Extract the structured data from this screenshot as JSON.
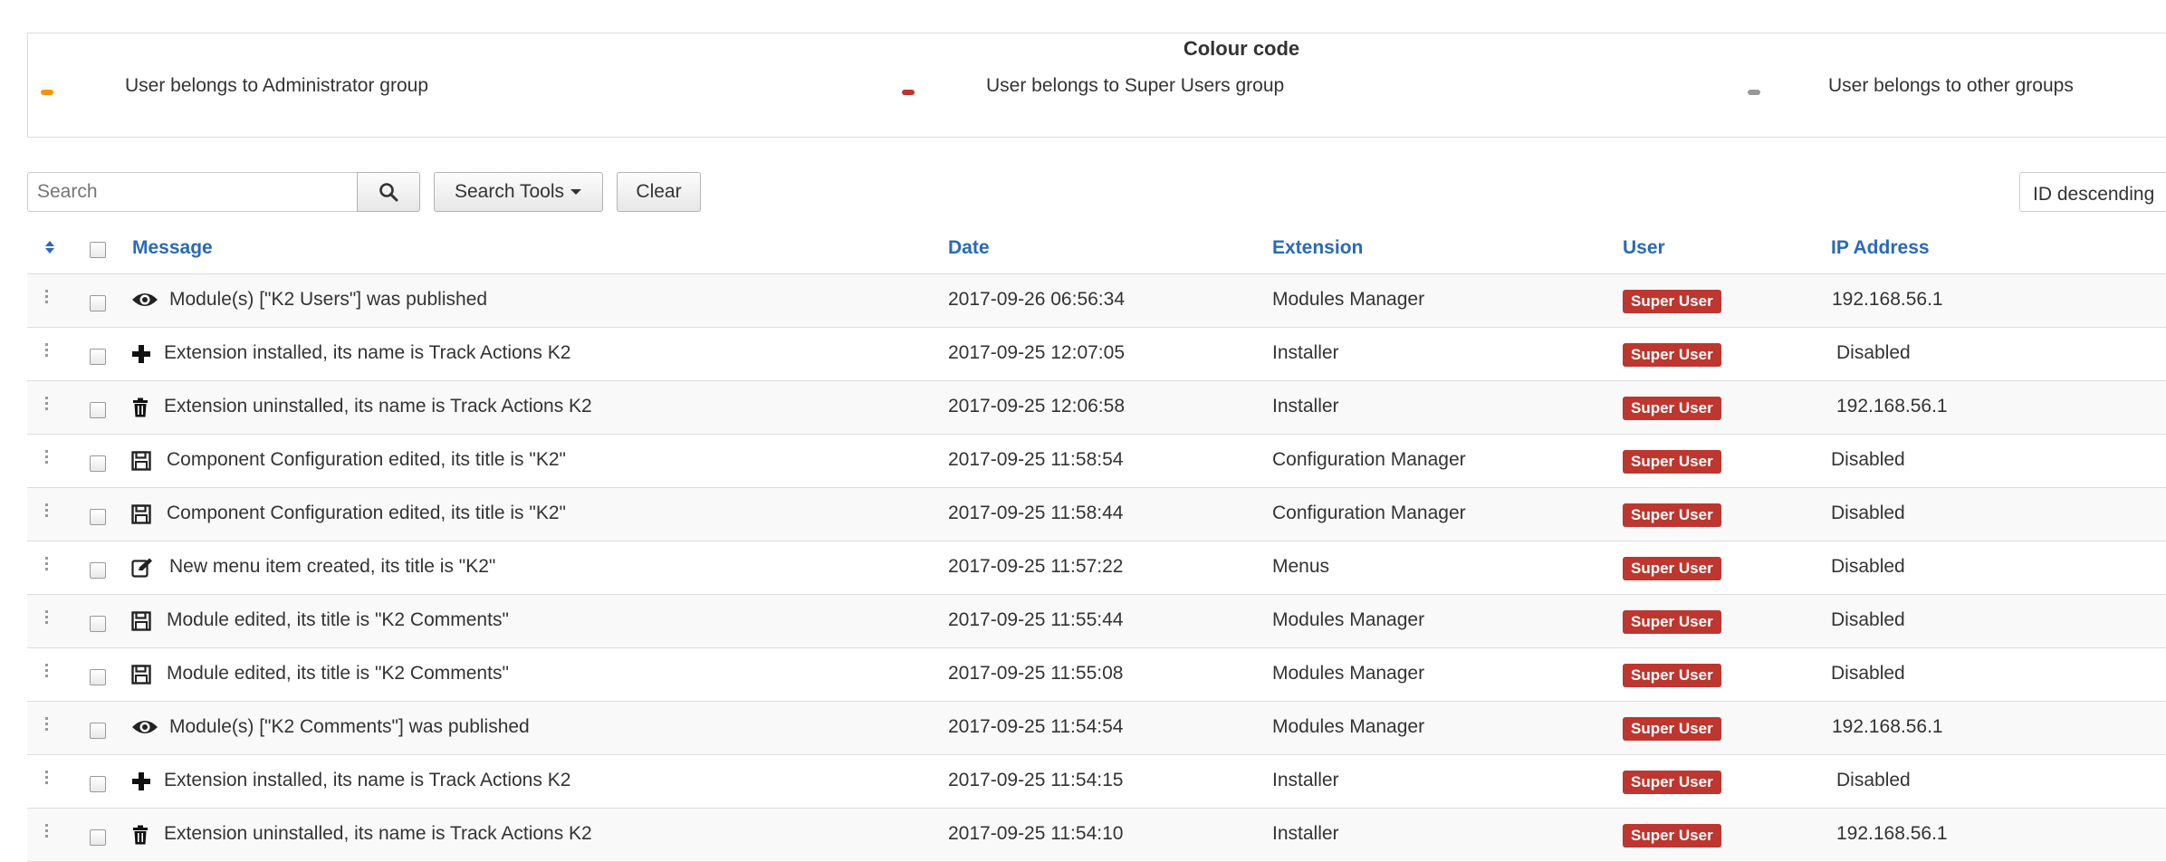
{
  "legend": {
    "title": "Colour code",
    "items": [
      {
        "label": "User belongs to Administrator group",
        "color": "#f89406"
      },
      {
        "label": "User belongs to Super Users group",
        "color": "#bd362f"
      },
      {
        "label": "User belongs to other groups",
        "color": "#999999"
      }
    ]
  },
  "toolbar": {
    "search_placeholder": "Search",
    "search_tools_label": "Search Tools",
    "clear_label": "Clear",
    "sort_label": "ID descending"
  },
  "table": {
    "headers": {
      "message": "Message",
      "date": "Date",
      "extension": "Extension",
      "user": "User",
      "ip": "IP Address"
    },
    "rows": [
      {
        "icon": "eye-icon",
        "message": "Module(s) [\"K2 Users\"] was published",
        "date": "2017-09-26 06:56:34",
        "extension": "Modules Manager",
        "user": "Super User",
        "ip": "192.168.56.1"
      },
      {
        "icon": "plus-icon",
        "message": "Extension installed, its name is Track Actions K2",
        "date": "2017-09-25 12:07:05",
        "extension": "Installer",
        "user": "Super User",
        "ip": "Disabled"
      },
      {
        "icon": "trash-icon",
        "message": "Extension uninstalled, its name is Track Actions K2",
        "date": "2017-09-25 12:06:58",
        "extension": "Installer",
        "user": "Super User",
        "ip": "192.168.56.1"
      },
      {
        "icon": "save-icon",
        "message": "Component Configuration edited, its title is \"K2\"",
        "date": "2017-09-25 11:58:54",
        "extension": "Configuration Manager",
        "user": "Super User",
        "ip": "Disabled"
      },
      {
        "icon": "save-icon",
        "message": "Component Configuration edited, its title is \"K2\"",
        "date": "2017-09-25 11:58:44",
        "extension": "Configuration Manager",
        "user": "Super User",
        "ip": "Disabled"
      },
      {
        "icon": "edit-icon",
        "message": "New menu item created, its title is \"K2\"",
        "date": "2017-09-25 11:57:22",
        "extension": "Menus",
        "user": "Super User",
        "ip": "Disabled"
      },
      {
        "icon": "save-icon",
        "message": "Module edited, its title is \"K2 Comments\"",
        "date": "2017-09-25 11:55:44",
        "extension": "Modules Manager",
        "user": "Super User",
        "ip": "Disabled"
      },
      {
        "icon": "save-icon",
        "message": "Module edited, its title is \"K2 Comments\"",
        "date": "2017-09-25 11:55:08",
        "extension": "Modules Manager",
        "user": "Super User",
        "ip": "Disabled"
      },
      {
        "icon": "eye-icon",
        "message": "Module(s) [\"K2 Comments\"] was published",
        "date": "2017-09-25 11:54:54",
        "extension": "Modules Manager",
        "user": "Super User",
        "ip": "192.168.56.1"
      },
      {
        "icon": "plus-icon",
        "message": "Extension installed, its name is Track Actions K2",
        "date": "2017-09-25 11:54:15",
        "extension": "Installer",
        "user": "Super User",
        "ip": "Disabled"
      },
      {
        "icon": "trash-icon",
        "message": "Extension uninstalled, its name is Track Actions K2",
        "date": "2017-09-25 11:54:10",
        "extension": "Installer",
        "user": "Super User",
        "ip": "192.168.56.1"
      }
    ]
  }
}
